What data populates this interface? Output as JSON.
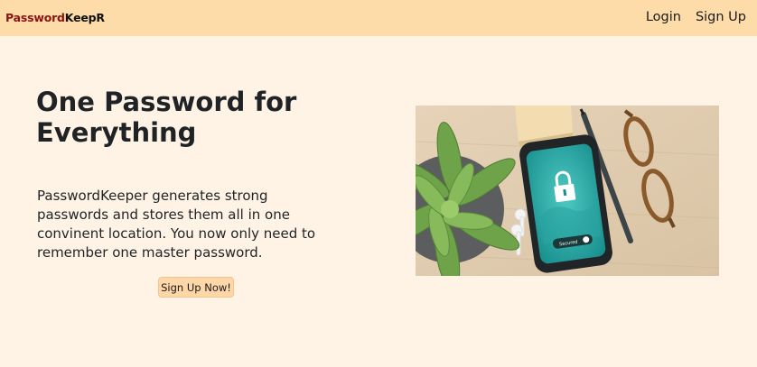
{
  "navbar": {
    "brand_part1": "Password",
    "brand_part2": "KeepR",
    "links": [
      "Login",
      "Sign Up"
    ]
  },
  "hero": {
    "title": "One Password for Everything",
    "description": "PasswordKeeper generates strong passwords and stores them all in one convinent location. You now only need to remember one master password.",
    "cta_label": "Sign Up Now!"
  },
  "image": {
    "phone_text": "Secured"
  },
  "colors": {
    "navbar_bg": "#fedcaa",
    "page_bg": "#fff3e5",
    "brand_accent": "#8b1414",
    "cta_bg": "#fed7a8"
  }
}
